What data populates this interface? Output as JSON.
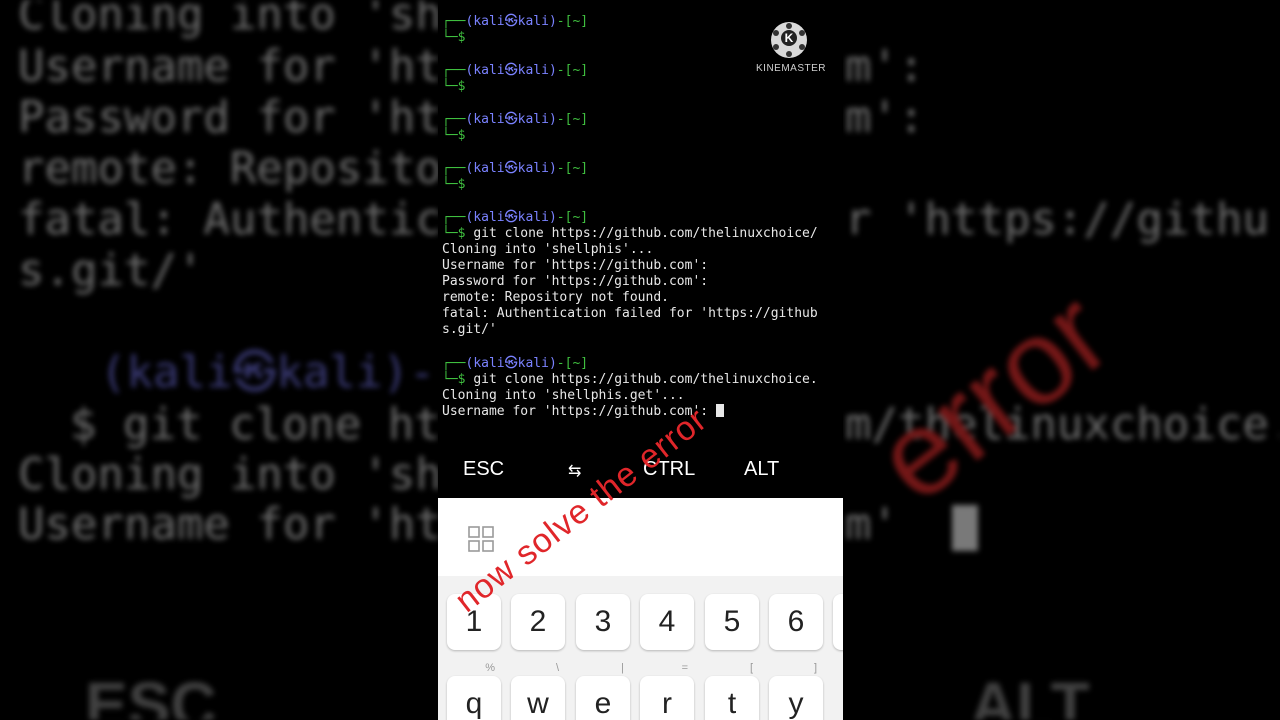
{
  "terminal": {
    "prompt_user": "kali",
    "prompt_host": "kali",
    "prompt_dir": "~",
    "cmd1": "git clone https://github.com/thelinuxchoice/",
    "out1": [
      "Cloning into 'shellphis'...",
      "Username for 'https://github.com':",
      "Password for 'https://github.com':",
      "remote: Repository not found.",
      "fatal: Authentication failed for 'https://github",
      "s.git/'"
    ],
    "cmd2": "git clone https://github.com/thelinuxchoice.",
    "out2": [
      "Cloning into 'shellphis.get'...",
      "Username for 'https://github.com':"
    ]
  },
  "extra_keys": {
    "esc": "ESC",
    "tab": "⇆",
    "ctrl": "CTRL",
    "alt": "ALT"
  },
  "keyboard": {
    "numbers": [
      "1",
      "2",
      "3",
      "4",
      "5",
      "6"
    ],
    "letters": [
      "q",
      "w",
      "e",
      "r",
      "t",
      "y"
    ],
    "letter_subs": [
      "%",
      "\\",
      "|",
      "=",
      "[",
      "]"
    ]
  },
  "overlay_text": "now solve the error",
  "logo": {
    "name": "KINEMASTER",
    "letter": "K"
  },
  "background": {
    "lines": [
      "Cloning into 'sh",
      "Username for 'ht",
      "Password for 'ht",
      "remote: Reposito",
      "fatal: Authentic",
      "s.git/'"
    ],
    "right_lines": [
      "m':",
      "m':",
      "r 'https://githu"
    ],
    "prompt": "(kali㉿kali)-",
    "cmd_prefix": "$ git clone ht",
    "cmd_suffix": "m/thelinuxchoice.",
    "lines2": [
      "Cloning into 'sh",
      "Username for 'ht"
    ],
    "right2": "m'",
    "keys": [
      "ESC",
      "ALT"
    ],
    "error_word": "error"
  },
  "colors": {
    "prompt_green": "#3fbf3f",
    "prompt_blue": "#7a82ff",
    "overlay_red": "#e0262a"
  }
}
